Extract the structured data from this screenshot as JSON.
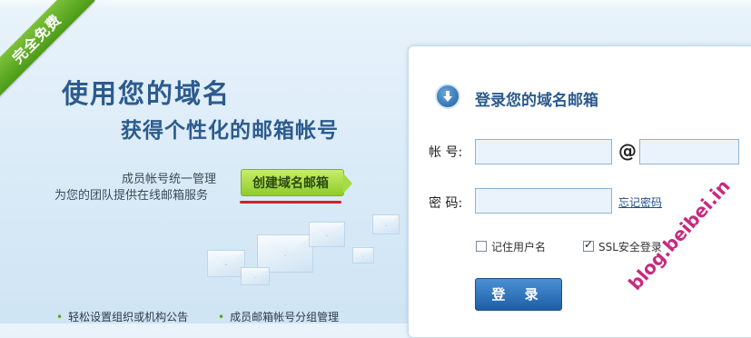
{
  "promo": {
    "ribbon": "完全免费",
    "headline1": "使用您的域名",
    "headline2": "获得个性化的邮箱帐号",
    "desc_line1": "成员帐号统一管理",
    "desc_line2": "为您的团队提供在线邮箱服务",
    "create_button": "创建域名邮箱",
    "features": [
      "轻松设置组织或机构公告",
      "成员邮箱帐号分组管理"
    ]
  },
  "login": {
    "title": "登录您的域名邮箱",
    "account_label": "帐 号:",
    "at_sign": "@",
    "password_label": "密 码:",
    "forgot_link": "忘记密码",
    "remember_label": "记住用户名",
    "remember_checked": false,
    "ssl_label": "SSL安全登录",
    "ssl_checked": true,
    "login_button": "登 录",
    "account_value": "",
    "domain_value": "",
    "password_value": ""
  },
  "watermark": "blog.beibei.in",
  "colors": {
    "headline": "#2c5b8e",
    "ribbon": "#5aa323",
    "create_button": "#9ad33a",
    "login_button": "#2a6cb5",
    "underline_mark": "#d0202a",
    "watermark": "#c72a7e"
  }
}
